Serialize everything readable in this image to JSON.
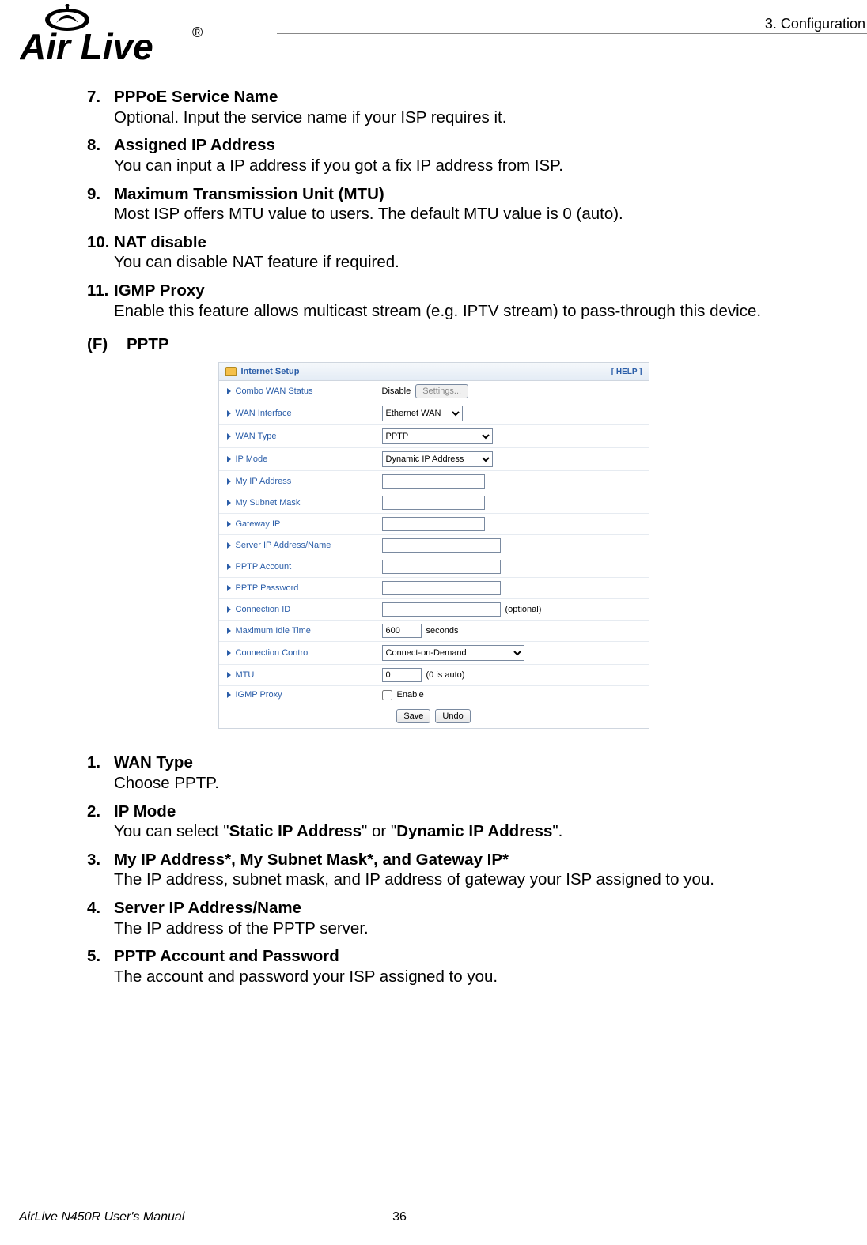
{
  "header": {
    "section_tag": "3.  Configuration",
    "logo_text": "Air Live",
    "logo_reg": "®"
  },
  "list_a": [
    {
      "num": "7.",
      "title": "PPPoE Service Name",
      "body": "Optional. Input the service name if your ISP requires it."
    },
    {
      "num": "8.",
      "title": "Assigned IP Address",
      "body": "You can input a IP address if you got a fix IP address from ISP."
    },
    {
      "num": "9.",
      "title": "Maximum Transmission Unit (MTU)",
      "body": "Most ISP offers MTU value to users. The default MTU value is 0 (auto)."
    },
    {
      "num": "10.",
      "title": "NAT disable",
      "body": "You can disable NAT feature if required."
    },
    {
      "num": "11.",
      "title": "IGMP Proxy",
      "body": "Enable this feature allows multicast stream (e.g. IPTV stream) to pass-through this device."
    }
  ],
  "section_f": {
    "paren": "(F)",
    "label": "PPTP"
  },
  "panel": {
    "title": "Internet Setup",
    "help": "[ HELP ]",
    "rows": {
      "combo_wan": {
        "label": "Combo WAN Status",
        "text": "Disable",
        "btn": "Settings..."
      },
      "wan_if": {
        "label": "WAN Interface",
        "value": "Ethernet WAN"
      },
      "wan_type": {
        "label": "WAN Type",
        "value": "PPTP"
      },
      "ip_mode": {
        "label": "IP Mode",
        "value": "Dynamic IP Address"
      },
      "my_ip": {
        "label": "My IP Address",
        "value": ""
      },
      "my_mask": {
        "label": "My Subnet Mask",
        "value": ""
      },
      "gw": {
        "label": "Gateway IP",
        "value": ""
      },
      "server": {
        "label": "Server IP Address/Name",
        "value": ""
      },
      "acct": {
        "label": "PPTP Account",
        "value": ""
      },
      "pass": {
        "label": "PPTP Password",
        "value": ""
      },
      "connid": {
        "label": "Connection ID",
        "value": "",
        "suffix": "(optional)"
      },
      "idle": {
        "label": "Maximum Idle Time",
        "value": "600",
        "suffix": "seconds"
      },
      "connctrl": {
        "label": "Connection Control",
        "value": "Connect-on-Demand"
      },
      "mtu": {
        "label": "MTU",
        "value": "0",
        "suffix": "(0 is auto)"
      },
      "igmp": {
        "label": "IGMP Proxy",
        "checked": false,
        "suffix": "Enable"
      }
    },
    "save": "Save",
    "undo": "Undo"
  },
  "list_b": [
    {
      "num": "1.",
      "title_html": [
        [
          "b",
          "WAN Type"
        ]
      ],
      "body_html": [
        [
          "",
          "Choose PPTP."
        ]
      ]
    },
    {
      "num": "2.",
      "title_html": [
        [
          "b",
          "IP Mode"
        ]
      ],
      "body_html": [
        [
          "",
          "You can select \""
        ],
        [
          "b",
          "Static IP Address"
        ],
        [
          "",
          "\" or \""
        ],
        [
          "b",
          "Dynamic IP Address"
        ],
        [
          "",
          "\"."
        ]
      ]
    },
    {
      "num": "3.",
      "title_html": [
        [
          "b",
          "My IP Address*"
        ],
        [
          "",
          ", "
        ],
        [
          "b",
          "My Subnet Mask*, and Gateway IP*"
        ]
      ],
      "body_html": [
        [
          "",
          "The IP address, subnet mask, and IP address of gateway your ISP assigned to you."
        ]
      ]
    },
    {
      "num": "4.",
      "title_html": [
        [
          "b",
          "Server IP Address/Name"
        ]
      ],
      "body_html": [
        [
          "",
          "The IP address of the PPTP server."
        ]
      ]
    },
    {
      "num": "5.",
      "title_html": [
        [
          "b",
          "PPTP Account"
        ],
        [
          "",
          " and "
        ],
        [
          "b",
          "Password"
        ]
      ],
      "body_html": [
        [
          "",
          "The account and password your ISP assigned to you."
        ]
      ]
    }
  ],
  "footer": {
    "left": "AirLive N450R User's Manual",
    "page": "36"
  }
}
